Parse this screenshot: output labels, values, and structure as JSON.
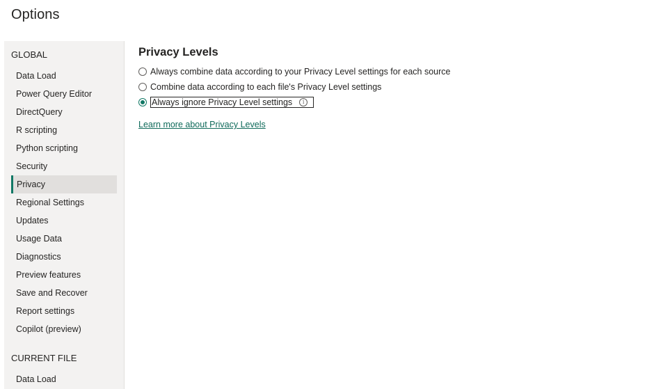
{
  "window": {
    "title": "Options"
  },
  "sidebar": {
    "global_heading": "GLOBAL",
    "global_items": [
      {
        "label": "Data Load"
      },
      {
        "label": "Power Query Editor"
      },
      {
        "label": "DirectQuery"
      },
      {
        "label": "R scripting"
      },
      {
        "label": "Python scripting"
      },
      {
        "label": "Security"
      },
      {
        "label": "Privacy",
        "selected": true
      },
      {
        "label": "Regional Settings"
      },
      {
        "label": "Updates"
      },
      {
        "label": "Usage Data"
      },
      {
        "label": "Diagnostics"
      },
      {
        "label": "Preview features"
      },
      {
        "label": "Save and Recover"
      },
      {
        "label": "Report settings"
      },
      {
        "label": "Copilot (preview)"
      }
    ],
    "current_file_heading": "CURRENT FILE",
    "current_file_items": [
      {
        "label": "Data Load"
      }
    ]
  },
  "main": {
    "title": "Privacy Levels",
    "options": [
      {
        "label": "Always combine data according to your Privacy Level settings for each source",
        "checked": false
      },
      {
        "label": "Combine data according to each file's Privacy Level settings",
        "checked": false
      },
      {
        "label": "Always ignore Privacy Level settings",
        "checked": true,
        "info_icon": "info-icon"
      }
    ],
    "learn_more_link": "Learn more about Privacy Levels"
  },
  "colors": {
    "accent": "#117865",
    "sidebar_bg": "#f3f2f1",
    "selected_bg": "#e1dfdd",
    "link": "#0f6a5a"
  }
}
